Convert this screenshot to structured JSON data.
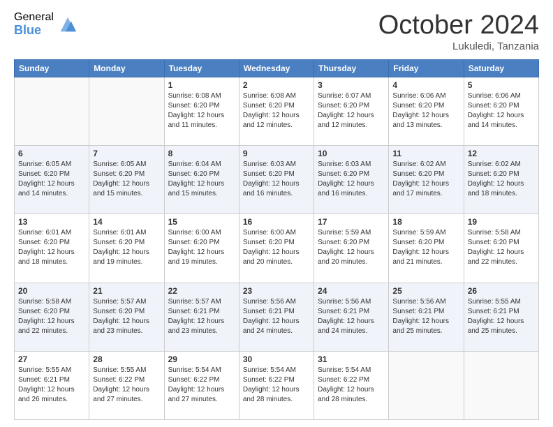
{
  "logo": {
    "general": "General",
    "blue": "Blue"
  },
  "header": {
    "month": "October 2024",
    "location": "Lukuledi, Tanzania"
  },
  "weekdays": [
    "Sunday",
    "Monday",
    "Tuesday",
    "Wednesday",
    "Thursday",
    "Friday",
    "Saturday"
  ],
  "weeks": [
    [
      {
        "day": "",
        "empty": true
      },
      {
        "day": "",
        "empty": true
      },
      {
        "day": "1",
        "sunrise": "6:08 AM",
        "sunset": "6:20 PM",
        "daylight": "12 hours and 11 minutes."
      },
      {
        "day": "2",
        "sunrise": "6:08 AM",
        "sunset": "6:20 PM",
        "daylight": "12 hours and 12 minutes."
      },
      {
        "day": "3",
        "sunrise": "6:07 AM",
        "sunset": "6:20 PM",
        "daylight": "12 hours and 12 minutes."
      },
      {
        "day": "4",
        "sunrise": "6:06 AM",
        "sunset": "6:20 PM",
        "daylight": "12 hours and 13 minutes."
      },
      {
        "day": "5",
        "sunrise": "6:06 AM",
        "sunset": "6:20 PM",
        "daylight": "12 hours and 14 minutes."
      }
    ],
    [
      {
        "day": "6",
        "sunrise": "6:05 AM",
        "sunset": "6:20 PM",
        "daylight": "12 hours and 14 minutes."
      },
      {
        "day": "7",
        "sunrise": "6:05 AM",
        "sunset": "6:20 PM",
        "daylight": "12 hours and 15 minutes."
      },
      {
        "day": "8",
        "sunrise": "6:04 AM",
        "sunset": "6:20 PM",
        "daylight": "12 hours and 15 minutes."
      },
      {
        "day": "9",
        "sunrise": "6:03 AM",
        "sunset": "6:20 PM",
        "daylight": "12 hours and 16 minutes."
      },
      {
        "day": "10",
        "sunrise": "6:03 AM",
        "sunset": "6:20 PM",
        "daylight": "12 hours and 16 minutes."
      },
      {
        "day": "11",
        "sunrise": "6:02 AM",
        "sunset": "6:20 PM",
        "daylight": "12 hours and 17 minutes."
      },
      {
        "day": "12",
        "sunrise": "6:02 AM",
        "sunset": "6:20 PM",
        "daylight": "12 hours and 18 minutes."
      }
    ],
    [
      {
        "day": "13",
        "sunrise": "6:01 AM",
        "sunset": "6:20 PM",
        "daylight": "12 hours and 18 minutes."
      },
      {
        "day": "14",
        "sunrise": "6:01 AM",
        "sunset": "6:20 PM",
        "daylight": "12 hours and 19 minutes."
      },
      {
        "day": "15",
        "sunrise": "6:00 AM",
        "sunset": "6:20 PM",
        "daylight": "12 hours and 19 minutes."
      },
      {
        "day": "16",
        "sunrise": "6:00 AM",
        "sunset": "6:20 PM",
        "daylight": "12 hours and 20 minutes."
      },
      {
        "day": "17",
        "sunrise": "5:59 AM",
        "sunset": "6:20 PM",
        "daylight": "12 hours and 20 minutes."
      },
      {
        "day": "18",
        "sunrise": "5:59 AM",
        "sunset": "6:20 PM",
        "daylight": "12 hours and 21 minutes."
      },
      {
        "day": "19",
        "sunrise": "5:58 AM",
        "sunset": "6:20 PM",
        "daylight": "12 hours and 22 minutes."
      }
    ],
    [
      {
        "day": "20",
        "sunrise": "5:58 AM",
        "sunset": "6:20 PM",
        "daylight": "12 hours and 22 minutes."
      },
      {
        "day": "21",
        "sunrise": "5:57 AM",
        "sunset": "6:20 PM",
        "daylight": "12 hours and 23 minutes."
      },
      {
        "day": "22",
        "sunrise": "5:57 AM",
        "sunset": "6:21 PM",
        "daylight": "12 hours and 23 minutes."
      },
      {
        "day": "23",
        "sunrise": "5:56 AM",
        "sunset": "6:21 PM",
        "daylight": "12 hours and 24 minutes."
      },
      {
        "day": "24",
        "sunrise": "5:56 AM",
        "sunset": "6:21 PM",
        "daylight": "12 hours and 24 minutes."
      },
      {
        "day": "25",
        "sunrise": "5:56 AM",
        "sunset": "6:21 PM",
        "daylight": "12 hours and 25 minutes."
      },
      {
        "day": "26",
        "sunrise": "5:55 AM",
        "sunset": "6:21 PM",
        "daylight": "12 hours and 25 minutes."
      }
    ],
    [
      {
        "day": "27",
        "sunrise": "5:55 AM",
        "sunset": "6:21 PM",
        "daylight": "12 hours and 26 minutes."
      },
      {
        "day": "28",
        "sunrise": "5:55 AM",
        "sunset": "6:22 PM",
        "daylight": "12 hours and 27 minutes."
      },
      {
        "day": "29",
        "sunrise": "5:54 AM",
        "sunset": "6:22 PM",
        "daylight": "12 hours and 27 minutes."
      },
      {
        "day": "30",
        "sunrise": "5:54 AM",
        "sunset": "6:22 PM",
        "daylight": "12 hours and 28 minutes."
      },
      {
        "day": "31",
        "sunrise": "5:54 AM",
        "sunset": "6:22 PM",
        "daylight": "12 hours and 28 minutes."
      },
      {
        "day": "",
        "empty": true
      },
      {
        "day": "",
        "empty": true
      }
    ]
  ],
  "labels": {
    "sunrise": "Sunrise:",
    "sunset": "Sunset:",
    "daylight": "Daylight:"
  }
}
